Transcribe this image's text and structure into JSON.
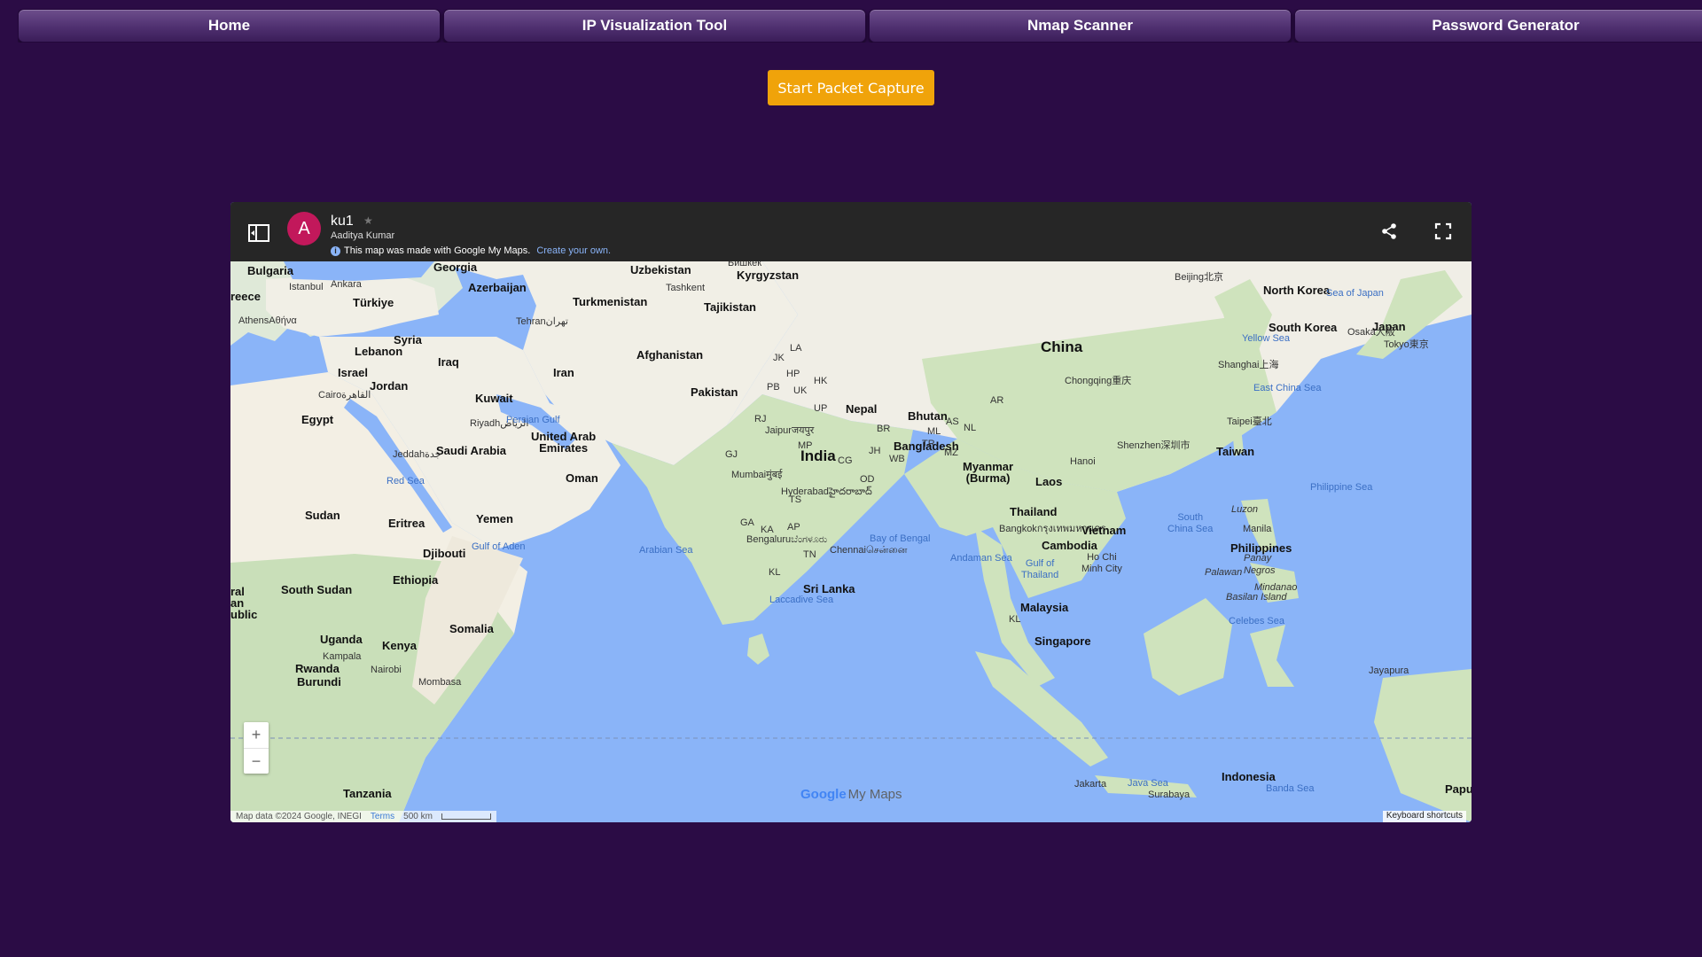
{
  "nav": [
    {
      "label": "Home"
    },
    {
      "label": "IP Visualization Tool"
    },
    {
      "label": "Nmap Scanner"
    },
    {
      "label": "Password Generator"
    }
  ],
  "capture_button": "Start Packet Capture",
  "map": {
    "avatar_letter": "A",
    "title": "ku1",
    "author": "Aaditya Kumar",
    "made_with": "This map was made with Google My Maps.",
    "create_link": "Create your own.",
    "zoom_in": "+",
    "zoom_out": "−",
    "logo_google": "Google",
    "logo_mymaps": "My Maps",
    "attribution": "Map data ©2024 Google, INEGI",
    "terms": "Terms",
    "scale": "500 km",
    "shortcuts": "Keyboard shortcuts",
    "labels": {
      "bulgaria": "Bulgaria",
      "greece": "reece",
      "istanbul": "Istanbul",
      "ankara": "Ankara",
      "turkiye": "Türkiye",
      "georgia": "Georgia",
      "azerbaijan": "Azerbaijan",
      "athens": "Athens",
      "athens_local": "Αθήνα",
      "syria": "Syria",
      "lebanon": "Lebanon",
      "israel": "Israel",
      "jordan": "Jordan",
      "iraq": "Iraq",
      "cairo": "Cairo",
      "cairo_local": "القاهرة",
      "egypt": "Egypt",
      "kuwait": "Kuwait",
      "riyadh": "Riyadh",
      "riyadh_local": "الرياض",
      "saudi": "Saudi Arabia",
      "jeddah": "Jeddah",
      "jeddah_local": "جدة",
      "red_sea": "Red Sea",
      "persian_gulf": "Persian Gulf",
      "uae": "United Arab",
      "uae2": "Emirates",
      "oman": "Oman",
      "yemen": "Yemen",
      "eritrea": "Eritrea",
      "sudan": "Sudan",
      "djibouti": "Djibouti",
      "gulf_aden": "Gulf of Aden",
      "ethiopia": "Ethiopia",
      "south_sudan": "South Sudan",
      "somalia": "Somalia",
      "uganda": "Uganda",
      "kampala": "Kampala",
      "kenya": "Kenya",
      "nairobi": "Nairobi",
      "mombasa": "Mombasa",
      "rwanda": "Rwanda",
      "burundi": "Burundi",
      "tanzania": "Tanzania",
      "ral": "ral",
      "an": "an",
      "ublic": "ublic",
      "uzbekistan": "Uzbekistan",
      "bishkek": "Бишкек",
      "kyrgyzstan": "Kyrgyzstan",
      "tashkent": "Tashkent",
      "turkmenistan": "Turkmenistan",
      "tajikistan": "Tajikistan",
      "tehran": "Tehran",
      "tehran_local": "تهران",
      "iran": "Iran",
      "afghanistan": "Afghanistan",
      "pakistan": "Pakistan",
      "arabian_sea": "Arabian Sea",
      "india": "India",
      "jaipur": "Jaipur",
      "jaipur_local": "जयपुर",
      "mumbai": "Mumbai",
      "mumbai_local": "मुंबई",
      "hyderabad": "Hyderabad",
      "hyderabad_local": "హైదరాబాద్",
      "bengaluru": "Bengaluru",
      "bengaluru_local": "ಬೆಂಗಳೂರು",
      "chennai": "Chennai",
      "chennai_local": "சென்னை",
      "sri_lanka": "Sri Lanka",
      "laccadive": "Laccadive Sea",
      "nepal": "Nepal",
      "bhutan": "Bhutan",
      "bangladesh": "Bangladesh",
      "bay_bengal": "Bay of Bengal",
      "myanmar": "Myanmar",
      "myanmar2": "(Burma)",
      "thailand": "Thailand",
      "bangkok": "Bangkok",
      "bangkok_local": "กรุงเทพมหานคร",
      "andaman": "Andaman Sea",
      "gulf_thailand": "Gulf of",
      "gulf_thailand2": "Thailand",
      "laos": "Laos",
      "hanoi": "Hanoi",
      "vietnam": "Vietnam",
      "cambodia": "Cambodia",
      "hcmc": "Ho Chi",
      "hcmc2": "Minh City",
      "malaysia": "Malaysia",
      "kl": "KL",
      "singapore": "Singapore",
      "jakarta": "Jakarta",
      "java_sea": "Java Sea",
      "surabaya": "Surabaya",
      "indonesia": "Indonesia",
      "banda": "Banda Sea",
      "china": "China",
      "beijing": "Beijing",
      "beijing_local": "北京",
      "chongqing": "Chongqing",
      "chongqing_local": "重庆",
      "shanghai": "Shanghai",
      "shanghai_local": "上海",
      "shenzhen": "Shenzhen",
      "shenzhen_local": "深圳市",
      "taipei": "Taipei",
      "taipei_local": "臺北",
      "taiwan": "Taiwan",
      "east_china_sea": "East China Sea",
      "yellow_sea": "Yellow Sea",
      "south_china_sea": "South",
      "south_china_sea2": "China Sea",
      "north_korea": "North Korea",
      "south_korea": "South Korea",
      "sea_japan": "Sea of Japan",
      "japan": "Japan",
      "osaka": "Osaka",
      "osaka_local": "大阪",
      "tokyo": "Tokyo",
      "tokyo_local": "東京",
      "philippine_sea": "Philippine Sea",
      "luzon": "Luzon",
      "manila": "Manila",
      "philippines": "Philippines",
      "panay": "Panay",
      "negros": "Negros",
      "palawan": "Palawan",
      "mindanao": "Mindanao",
      "basilan": "Basilan Island",
      "celebes": "Celebes Sea",
      "jayapura": "Jayapura",
      "papua": "Papua",
      "hk": "HK",
      "ar": "AR",
      "as": "AS",
      "ml": "ML",
      "mz": "MZ",
      "nl": "NL",
      "jk": "JK",
      "la": "LA",
      "hp": "HP",
      "pb": "PB",
      "uk": "UK",
      "rj": "RJ",
      "up": "UP",
      "br": "BR",
      "jh": "JH",
      "wb": "WB",
      "tr": "TR",
      "mp": "MP",
      "gj": "GJ",
      "cg": "CG",
      "od": "OD",
      "ts": "TS",
      "ga": "GA",
      "ka": "KA",
      "ap": "AP",
      "tn": "TN"
    }
  }
}
